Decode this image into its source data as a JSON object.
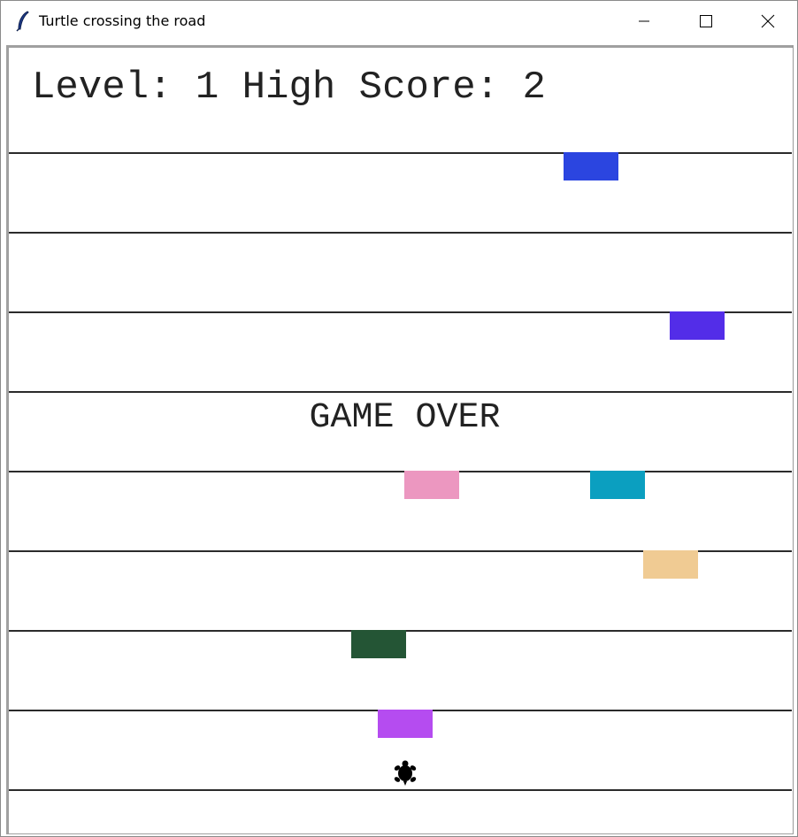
{
  "window": {
    "title": "Turtle crossing the road",
    "controls": {
      "minimize": "minimize",
      "maximize": "maximize",
      "close": "close"
    }
  },
  "game": {
    "scoreboard": "Level: 1 High Score: 2",
    "status": "GAME OVER",
    "cars": [
      {
        "color": "#2b45e0",
        "lane": 1
      },
      {
        "color": "#532de8",
        "lane": 3
      },
      {
        "color": "#ec97c0",
        "lane": 5
      },
      {
        "color": "#0b9fc0",
        "lane": 5
      },
      {
        "color": "#f0cb93",
        "lane": 6
      },
      {
        "color": "#245535",
        "lane": 7
      },
      {
        "color": "#b54cf0",
        "lane": 8
      }
    ],
    "player": {
      "icon": "turtle-icon",
      "color": "#000000"
    }
  }
}
